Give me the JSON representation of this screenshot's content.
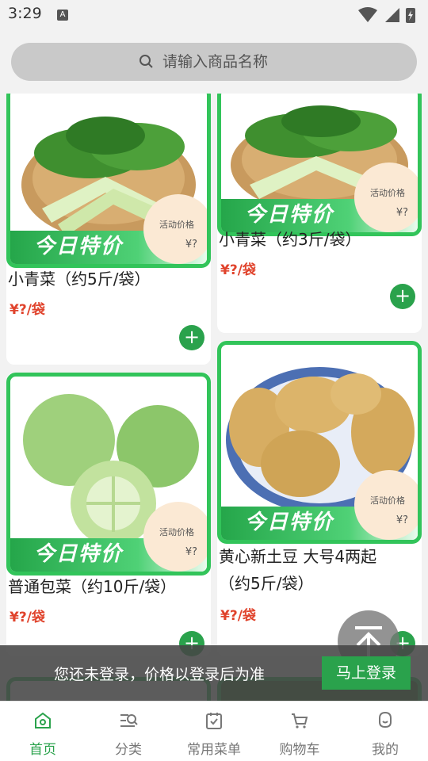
{
  "status": {
    "time": "3:29",
    "notif": "A"
  },
  "search": {
    "placeholder": "请输入商品名称"
  },
  "promo": {
    "banner": "今日特价",
    "badge_label": "活动价格",
    "badge_price": "¥?"
  },
  "products": [
    {
      "name": "小青菜（约5斤/袋）",
      "price": "¥?/袋"
    },
    {
      "name": "小青菜（约3斤/袋）",
      "price": "¥?/袋"
    },
    {
      "name": "普通包菜（约10斤/袋）",
      "price": "¥?/袋"
    },
    {
      "name_line1": "黄心新土豆 大号4两起",
      "name_line2": "（约5斤/袋）",
      "price": "¥?/袋"
    }
  ],
  "add_label": "+",
  "login": {
    "message": "您还未登录，价格以登录后为准",
    "button": "马上登录"
  },
  "tabs": [
    {
      "label": "首页",
      "icon": "home-icon",
      "active": true
    },
    {
      "label": "分类",
      "icon": "category-icon"
    },
    {
      "label": "常用菜单",
      "icon": "menu-list-icon"
    },
    {
      "label": "购物车",
      "icon": "cart-icon"
    },
    {
      "label": "我的",
      "icon": "user-icon"
    }
  ],
  "colors": {
    "accent": "#2aa24c",
    "price": "#e0432c",
    "banner": "#32c45a"
  }
}
